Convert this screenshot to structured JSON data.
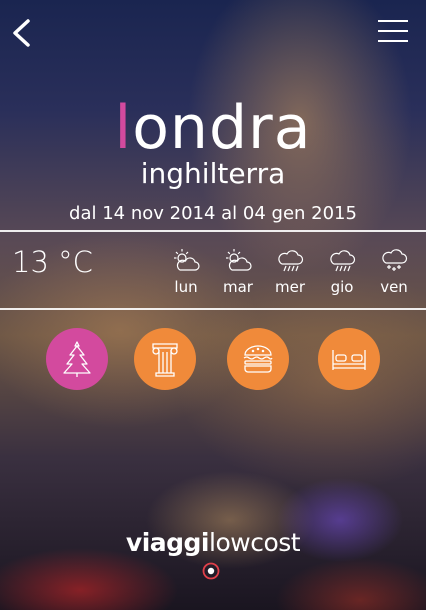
{
  "header": {
    "back_icon": "chevron-left-icon",
    "menu_icon": "hamburger-menu-icon"
  },
  "destination": {
    "city_initial": "l",
    "city_rest": "ondra",
    "country": "inghilterra",
    "dates": "dal 14 nov 2014 al 04 gen 2015"
  },
  "weather": {
    "temperature": "13 °C",
    "days": [
      {
        "label": "lun",
        "icon": "partly-cloudy-icon"
      },
      {
        "label": "mar",
        "icon": "partly-cloudy-icon"
      },
      {
        "label": "mer",
        "icon": "rain-icon"
      },
      {
        "label": "gio",
        "icon": "rain-icon"
      },
      {
        "label": "ven",
        "icon": "snow-icon"
      }
    ]
  },
  "categories": [
    {
      "icon": "christmas-tree-icon",
      "color": "#d34a9e"
    },
    {
      "icon": "column-icon",
      "color": "#f08a3a"
    },
    {
      "icon": "burger-icon",
      "color": "#f08a3a"
    },
    {
      "icon": "bed-icon",
      "color": "#f08a3a"
    }
  ],
  "brand": {
    "bold": "viaggi",
    "light": "lowcost"
  },
  "colors": {
    "accent_pink": "#d34a9e",
    "accent_orange": "#f08a3a",
    "indicator_red": "#e0404a"
  }
}
